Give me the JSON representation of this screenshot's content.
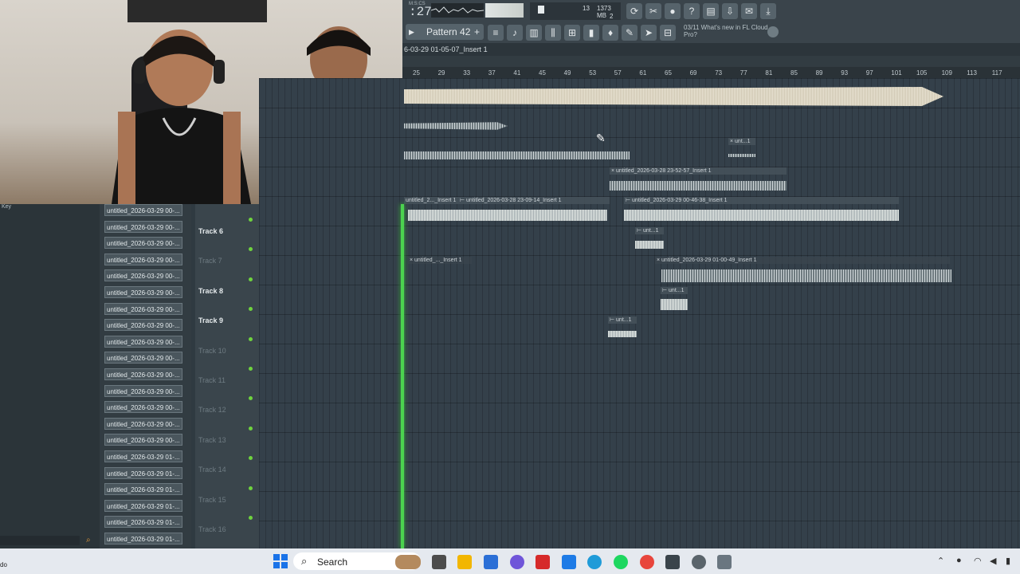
{
  "toolbar": {
    "time_label": "M:S:CS",
    "time": ":27",
    "cpu_value": "13",
    "memory": "1373 MB",
    "polyphony": "2",
    "pattern_label": "Pattern 42",
    "news_date": "03/11",
    "news_text": "What's new in FL Cloud Pro?"
  },
  "playlist": {
    "title": "6-03-29 01-05-07_Insert 1",
    "ruler": [
      "25",
      "29",
      "33",
      "37",
      "41",
      "45",
      "49",
      "53",
      "57",
      "61",
      "65",
      "69",
      "73",
      "77",
      "81",
      "85",
      "89",
      "93",
      "97",
      "101",
      "105",
      "109",
      "113",
      "117"
    ]
  },
  "browser": {
    "items": [
      "untitled_2026-03-29 00-...",
      "untitled_2026-03-29 00-...",
      "untitled_2026-03-29 00-...",
      "untitled_2026-03-29 00-...",
      "untitled_2026-03-29 00-...",
      "untitled_2026-03-29 00-...",
      "untitled_2026-03-29 00-...",
      "untitled_2026-03-29 00-...",
      "untitled_2026-03-29 00-...",
      "untitled_2026-03-29 00-...",
      "untitled_2026-03-29 00-...",
      "untitled_2026-03-29 00-...",
      "untitled_2026-03-29 00-...",
      "untitled_2026-03-29 00-...",
      "untitled_2026-03-29 00-...",
      "untitled_2026-03-29 01-...",
      "untitled_2026-03-29 01-...",
      "untitled_2026-03-29 01-...",
      "untitled_2026-03-29 01-...",
      "untitled_2026-03-29 01-...",
      "untitled_2026-03-29 01-..."
    ],
    "left_text": "Key"
  },
  "tracks": [
    {
      "name": "Track 6",
      "dim": false
    },
    {
      "name": "Track 7",
      "dim": true
    },
    {
      "name": "Track 8",
      "dim": false
    },
    {
      "name": "Track 9",
      "dim": false
    },
    {
      "name": "Track 10",
      "dim": true
    },
    {
      "name": "Track 11",
      "dim": true
    },
    {
      "name": "Track 12",
      "dim": true
    },
    {
      "name": "Track 13",
      "dim": true
    },
    {
      "name": "Track 14",
      "dim": true
    },
    {
      "name": "Track 15",
      "dim": true
    },
    {
      "name": "Track 16",
      "dim": true
    }
  ],
  "clips": {
    "c1": "× unt...1",
    "c2": "× untitled_2026-03-28 23-52-57_Insert 1",
    "c3": "untitled_2..._Insert 1",
    "c4": "⊢ untitled_2026-03-28 23-09-14_Insert 1",
    "c5": "⊢ untitled_2026-03-29 00-46-38_Insert 1",
    "c6": "⊢ unt...1",
    "c7": "× untitled_..._Insert 1",
    "c8": "× untitled_2026-03-29 01-00-49_Insert 1",
    "c9": "⊢ unt...1",
    "c10": "⊢ unt...1"
  },
  "taskbar": {
    "search": "Search",
    "left_text": "do"
  }
}
